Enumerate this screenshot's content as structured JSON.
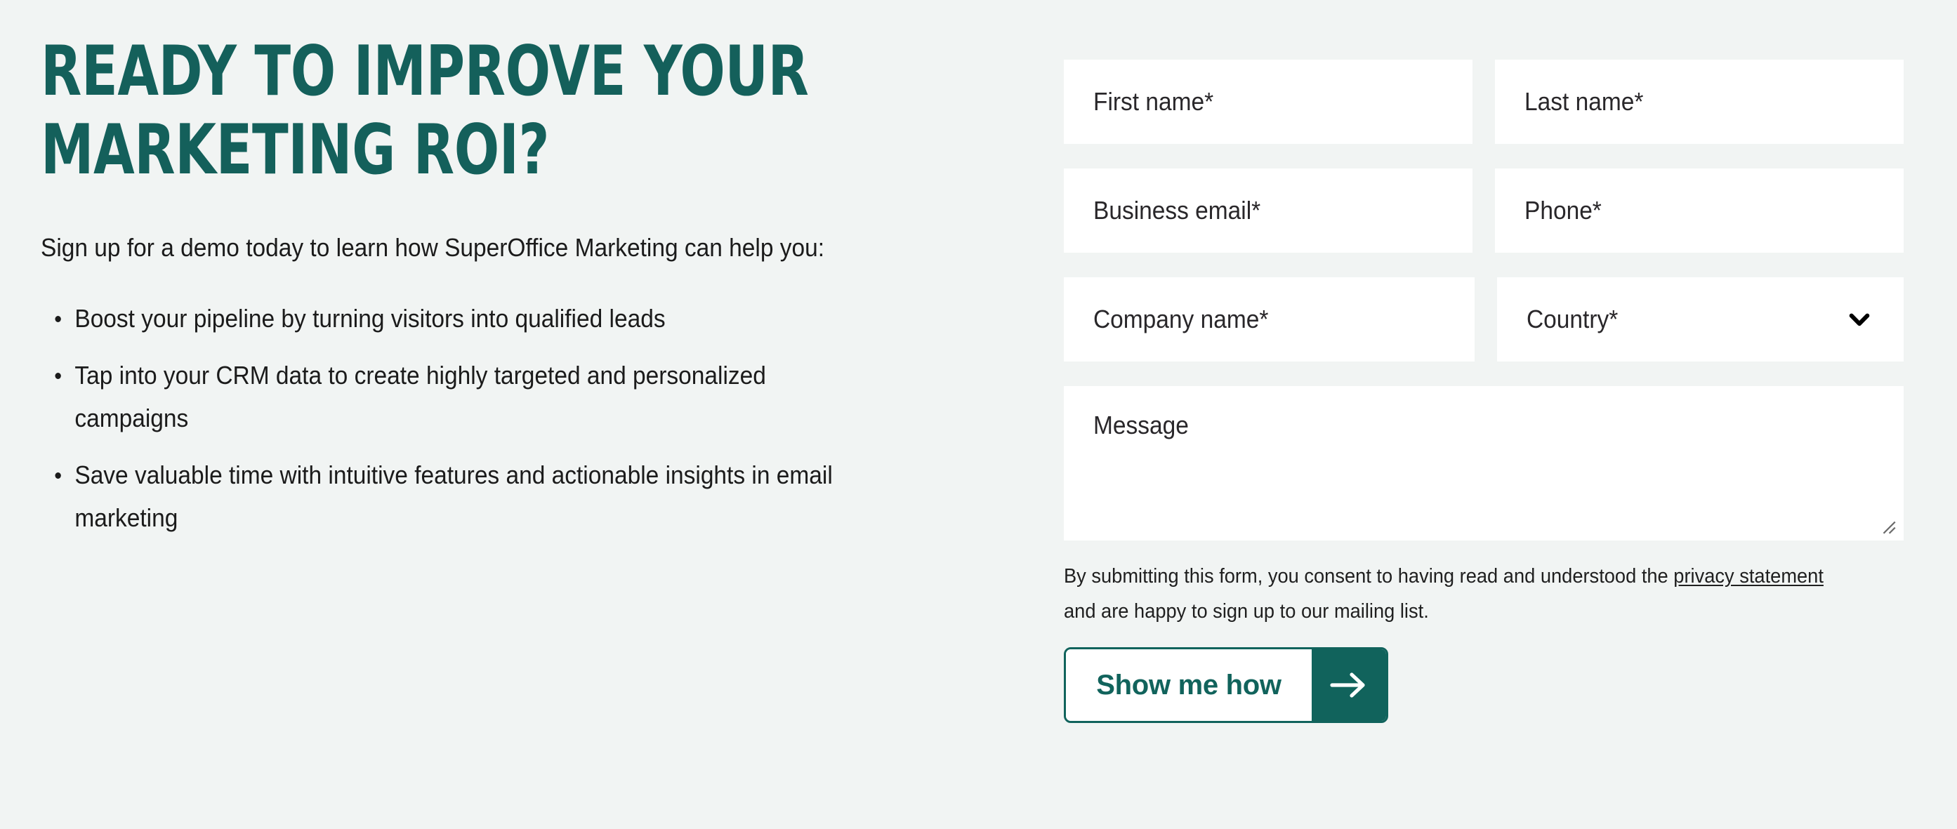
{
  "theme": {
    "background": "#f1f4f3",
    "accent_teal": "#14605b",
    "button_teal": "#11635c",
    "field_background": "#ffffff",
    "text_dark": "#1b1b1b"
  },
  "left": {
    "headline": "READY TO IMPROVE YOUR MARKETING ROI?",
    "intro": "Sign up for a demo today to learn how SuperOffice Marketing can help you:",
    "bullets": [
      "Boost your pipeline by turning visitors into qualified leads",
      "Tap into your CRM data to create highly targeted and personalized campaigns",
      "Save valuable time with intuitive features and actionable insights in email marketing"
    ]
  },
  "form": {
    "fields": {
      "first_name": "First name*",
      "last_name": "Last name*",
      "business_email": "Business email*",
      "phone": "Phone*",
      "company_name": "Company name*",
      "country": "Country*",
      "message": "Message"
    },
    "consent": {
      "lead": "By submitting this form, you consent to having read and understood the ",
      "link": "privacy statement",
      "tail": " and are happy to sign up to our mailing list."
    },
    "submit_label": "Show me how",
    "icons": {
      "country_chevron": "chevron-down-icon",
      "submit_arrow": "arrow-right-icon",
      "textarea_resize": "resize-grip-icon"
    }
  }
}
